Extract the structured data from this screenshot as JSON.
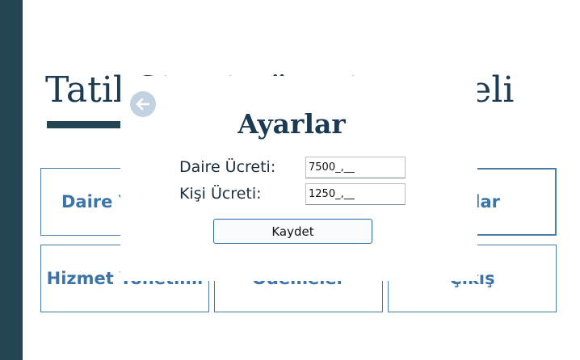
{
  "page": {
    "title": "Tatil Sitesi Yönetim Paneli"
  },
  "tiles": {
    "daire": "Daire Yönetimi",
    "ayarlar": "Ayarlar",
    "hizmet": "Hizmet Yönetimi",
    "odemeler": "Ödemeler",
    "cikis": "Çıkış"
  },
  "dialog": {
    "title": "Ayarlar",
    "back_icon": "arrow-left-circle-icon",
    "fields": {
      "daire_label": "Daire Ücreti:",
      "daire_value": "7500_,__",
      "kisi_label": "Kişi Ücreti:",
      "kisi_value": "1250_,__"
    },
    "save_label": "Kaydet"
  },
  "colors": {
    "sidebar": "#244654",
    "accent": "#3d74a8",
    "title": "#1c3a52"
  }
}
